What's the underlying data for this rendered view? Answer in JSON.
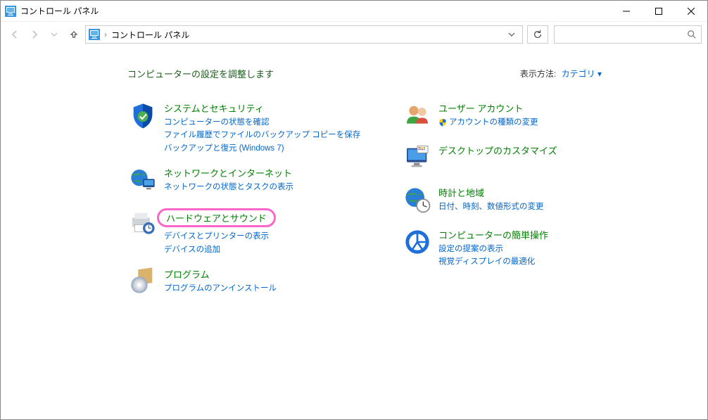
{
  "window": {
    "title": "コントロール パネル"
  },
  "nav": {
    "address_text": "コントロール パネル",
    "search_placeholder": ""
  },
  "header": {
    "title": "コンピューターの設定を調整します",
    "viewby_label": "表示方法:",
    "viewby_value": "カテゴリ"
  },
  "categories": {
    "left": [
      {
        "id": "system-security",
        "title": "システムとセキュリティ",
        "links": [
          {
            "text": "コンピューターの状態を確認",
            "shield": false
          },
          {
            "text": "ファイル履歴でファイルのバックアップ コピーを保存",
            "shield": false
          },
          {
            "text": "バックアップと復元 (Windows 7)",
            "shield": false
          }
        ]
      },
      {
        "id": "network-internet",
        "title": "ネットワークとインターネット",
        "links": [
          {
            "text": "ネットワークの状態とタスクの表示",
            "shield": false
          }
        ]
      },
      {
        "id": "hardware-sound",
        "title": "ハードウェアとサウンド",
        "highlight": true,
        "links": [
          {
            "text": "デバイスとプリンターの表示",
            "shield": false
          },
          {
            "text": "デバイスの追加",
            "shield": false
          }
        ]
      },
      {
        "id": "programs",
        "title": "プログラム",
        "links": [
          {
            "text": "プログラムのアンインストール",
            "shield": false
          }
        ]
      }
    ],
    "right": [
      {
        "id": "user-accounts",
        "title": "ユーザー アカウント",
        "links": [
          {
            "text": "アカウントの種類の変更",
            "shield": true
          }
        ]
      },
      {
        "id": "appearance",
        "title": "デスクトップのカスタマイズ",
        "links": []
      },
      {
        "id": "clock-region",
        "title": "時計と地域",
        "links": [
          {
            "text": "日付、時刻、数値形式の変更",
            "shield": false
          }
        ]
      },
      {
        "id": "ease-of-access",
        "title": "コンピューターの簡単操作",
        "links": [
          {
            "text": "設定の提案の表示",
            "shield": false
          },
          {
            "text": "視覚ディスプレイの最適化",
            "shield": false
          }
        ]
      }
    ]
  }
}
